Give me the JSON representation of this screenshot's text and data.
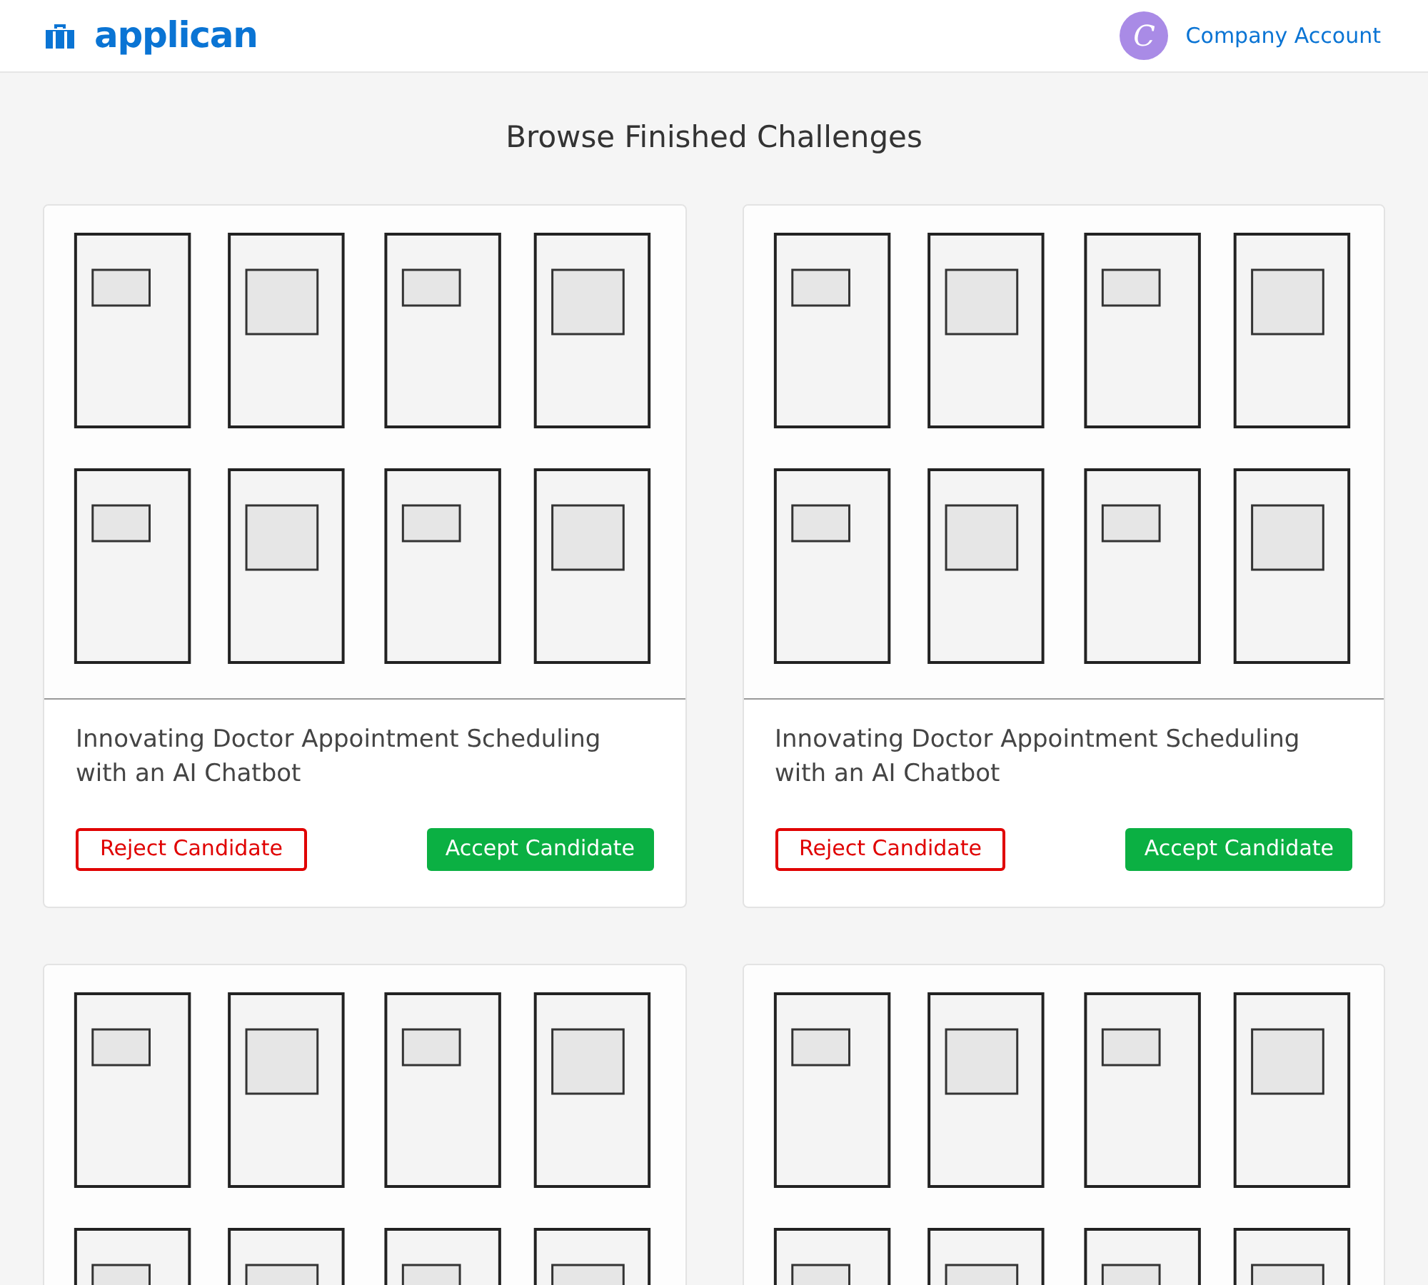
{
  "header": {
    "logo": "applican",
    "avatar_letter": "C",
    "account": "Company Account"
  },
  "page_title": "Browse Finished Challenges",
  "cards": [
    {
      "image": {
        "kind": "picture"
      },
      "title": "Innovating Doctor Appointment Scheduling with an AI Chatbot",
      "reject": "Reject Candidate",
      "accept": "Accept Candidate"
    },
    {
      "image": {
        "kind": "picture"
      },
      "title": "Innovating Doctor Appointment Scheduling with an AI Chatbot",
      "reject": "Reject Candidate",
      "accept": "Accept Candidate"
    },
    {
      "image": {
        "kind": "picture"
      }
    },
    {
      "image": {
        "kind": "picture"
      }
    }
  ]
}
